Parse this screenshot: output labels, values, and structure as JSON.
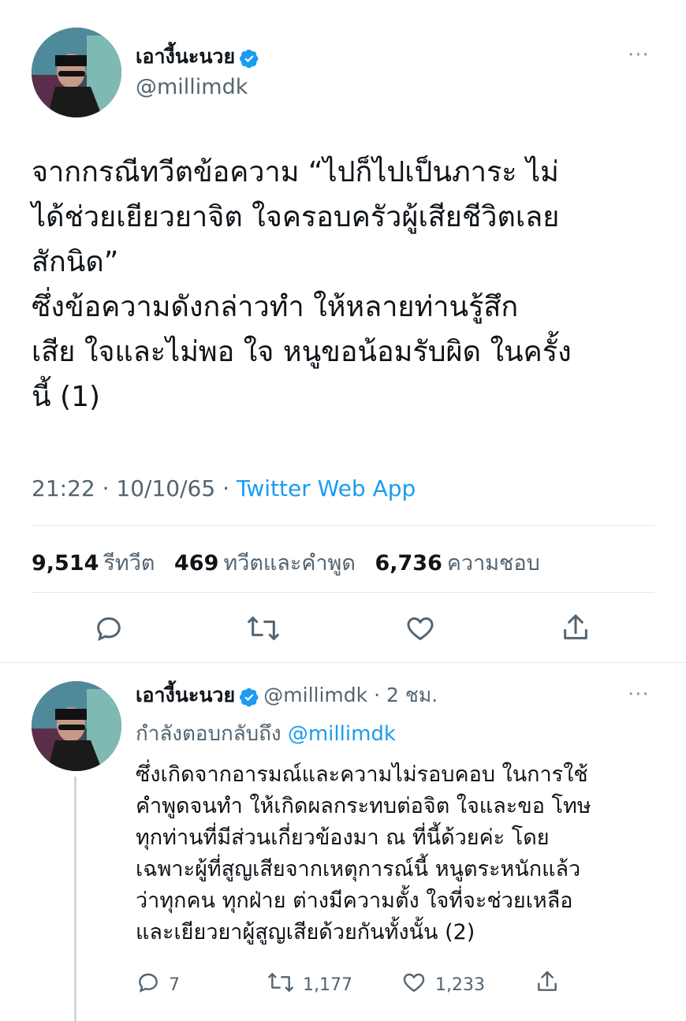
{
  "main_tweet": {
    "display_name": "เอางี้นะนวย",
    "handle": "@millimdk",
    "more": "···",
    "body_lines": [
      "จากกรณีทวีตข้อความ “ไปก็ไปเป็นภาระ ไม่",
      "ได้ช่วยเยียวยาจิต ใจครอบครัวผู้เสียชีวิตเลย",
      "สักนิด”",
      "ซึ่งข้อความดังกล่าวทำ ให้หลายท่านรู้สึก",
      "เสีย ใจและไม่พอ ใจ หนูขอน้อมรับผิด ในครั้ง",
      "นี้ (1)"
    ],
    "time": "21:22",
    "date": "10/10/65",
    "source": "Twitter Web App",
    "stats": {
      "retweets": "9,514",
      "retweets_label": "รีทวีต",
      "quotes": "469",
      "quotes_label": "ทวีตและคำพูด",
      "likes": "6,736",
      "likes_label": "ความชอบ"
    }
  },
  "reply_tweet": {
    "display_name": "เอางี้นะนวย",
    "handle": "@millimdk",
    "age": "2 ชม.",
    "more": "···",
    "replying_prefix": "กำลังตอบกลับถึง",
    "replying_to": "@millimdk",
    "body_lines": [
      "ซึ่งเกิดจากอารมณ์และความไม่รอบคอบ ในการใช้",
      "คำพูดจนทำ ให้เกิดผลกระทบต่อจิต ใจและขอ โทษ",
      "ทุกท่านที่มีส่วนเกี่ยวข้องมา ณ ที่นี้ด้วยค่ะ โดย",
      "เฉพาะผู้ที่สูญเสียจากเหตุการณ์นี้ หนูตระหนักแล้ว",
      "ว่าทุกคน ทุกฝ่าย ต่างมีความตั้ง ใจที่จะช่วยเหลือ",
      "และเยียวยาผู้สูญเสียด้วยกันทั้งนั้น (2)"
    ],
    "replies": "7",
    "retweets": "1,177",
    "likes": "1,233"
  },
  "colors": {
    "accent": "#1d9bf0",
    "muted": "#536471",
    "divider": "#e1e8ed"
  }
}
